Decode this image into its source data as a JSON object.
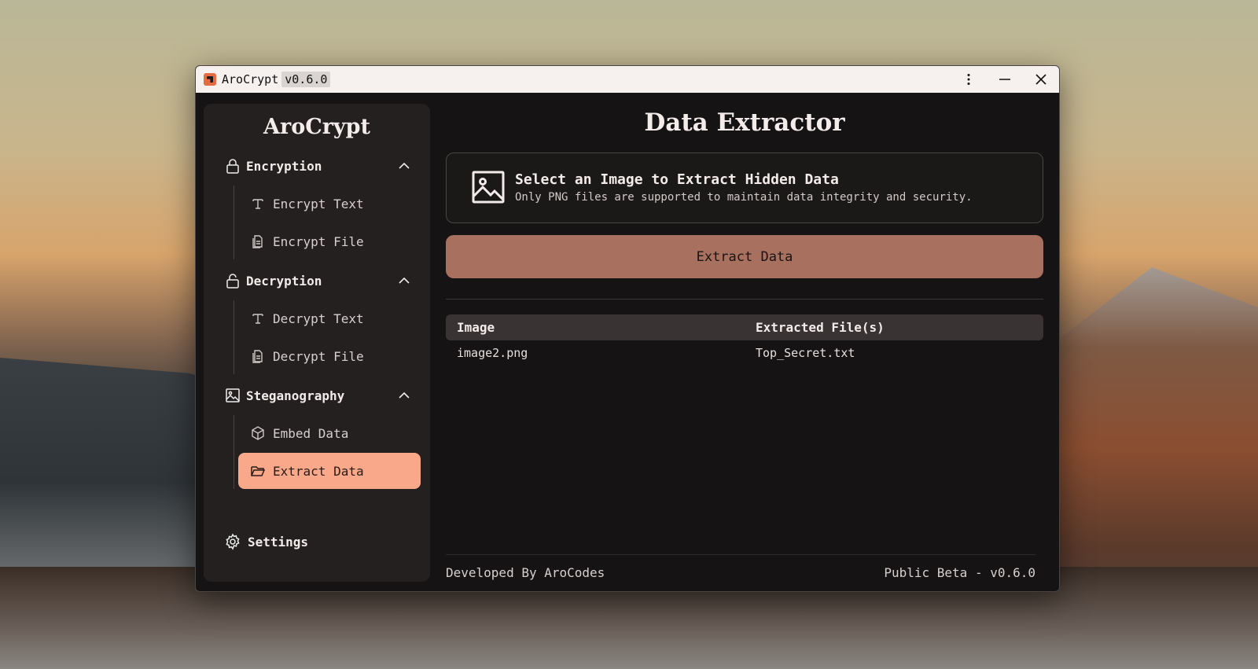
{
  "window": {
    "title": "AroCrypt",
    "version": "v0.6.0",
    "controls": [
      "more-icon",
      "minimize-icon",
      "close-icon"
    ]
  },
  "sidebar": {
    "brand": "AroCrypt",
    "groups": [
      {
        "label": "Encryption",
        "icon": "lock-icon",
        "items": [
          {
            "label": "Encrypt Text",
            "icon": "text-icon"
          },
          {
            "label": "Encrypt File",
            "icon": "file-icon"
          }
        ]
      },
      {
        "label": "Decryption",
        "icon": "unlock-icon",
        "items": [
          {
            "label": "Decrypt Text",
            "icon": "text-icon"
          },
          {
            "label": "Decrypt File",
            "icon": "file-icon"
          }
        ]
      },
      {
        "label": "Steganography",
        "icon": "image-icon",
        "items": [
          {
            "label": "Embed Data",
            "icon": "box-icon"
          },
          {
            "label": "Extract Data",
            "icon": "folder-open-icon",
            "active": true
          }
        ]
      }
    ],
    "settings": "Settings"
  },
  "main": {
    "title": "Data Extractor",
    "dropzone": {
      "title": "Select an Image to Extract Hidden Data",
      "subtitle": "Only PNG files are supported to maintain data integrity and security."
    },
    "action_button": "Extract Data",
    "table": {
      "columns": [
        "Image",
        "Extracted File(s)"
      ],
      "rows": [
        [
          "image2.png",
          "Top_Secret.txt"
        ]
      ]
    }
  },
  "footer": {
    "left": "Developed By AroCodes",
    "right": "Public Beta - v0.6.0"
  },
  "colors": {
    "accent": "#f9a98a",
    "button": "#a8705f",
    "window_bg": "#151313",
    "sidebar_bg": "#242020"
  }
}
